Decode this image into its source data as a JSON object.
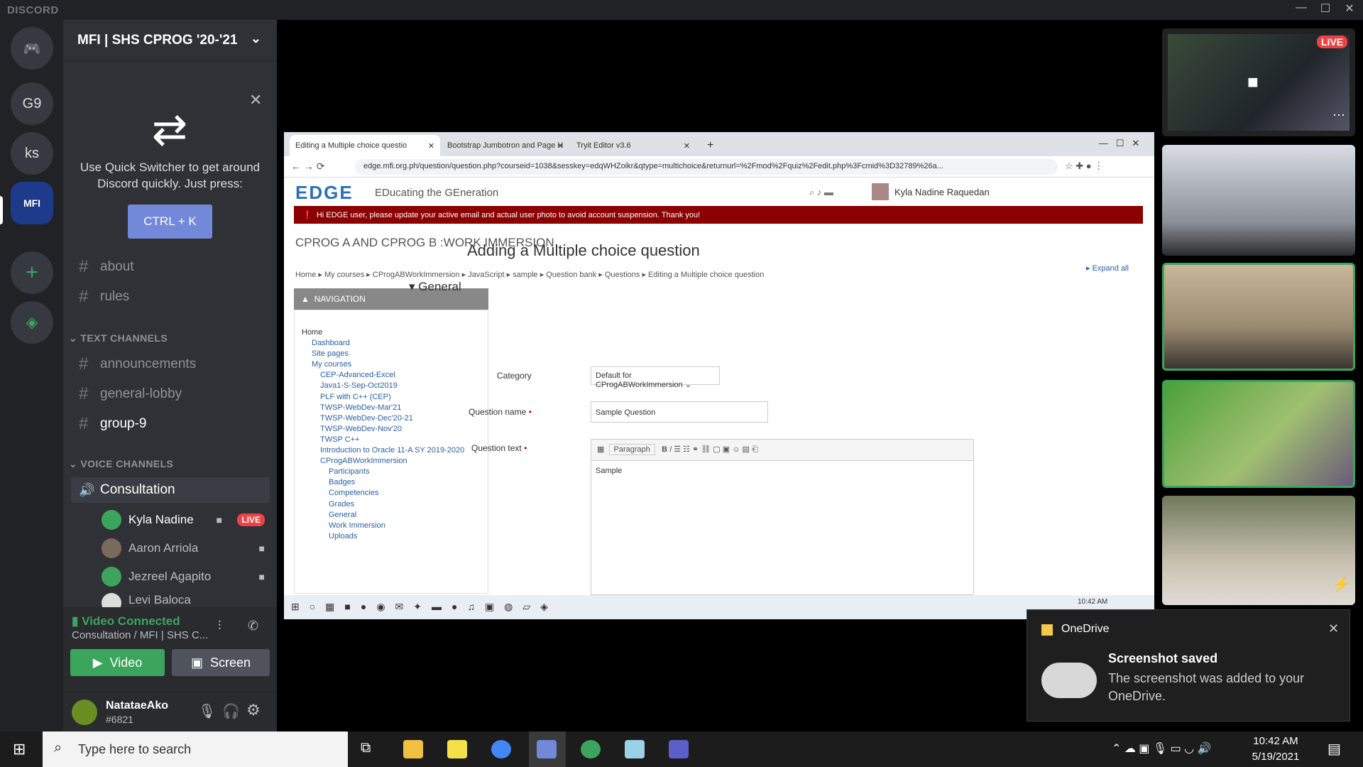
{
  "app": {
    "brand": "DISCORD"
  },
  "rail": {
    "servers": [
      "G9",
      "ks"
    ]
  },
  "guild": {
    "name": "MFI | SHS CPROG '20-'21"
  },
  "quick_switcher": {
    "text": "Use Quick Switcher to get around Discord quickly. Just press:",
    "shortcut": "CTRL + K"
  },
  "channels": {
    "top": [
      "about",
      "rules"
    ],
    "text_category": "TEXT CHANNELS",
    "text": [
      "announcements",
      "general-lobby",
      "group-9"
    ],
    "voice_category": "VOICE CHANNELS",
    "voice_channel": "Consultation",
    "voice_users": [
      "Kyla Nadine",
      "Aaron Arriola",
      "Jezreel Agapito",
      "Levi Baloca"
    ],
    "live_label": "LIVE"
  },
  "voice_panel": {
    "status": "Video Connected",
    "location": "Consultation / MFI | SHS C...",
    "video_label": "Video",
    "screen_label": "Screen"
  },
  "user_panel": {
    "name": "NatataeAko",
    "tag": "#6821"
  },
  "browser": {
    "tabs": [
      "Editing a Multiple choice questio",
      "Bootstrap Jumbotron and Page H",
      "Tryit Editor v3.6"
    ],
    "url": "edge.mfi.org.ph/question/question.php?courseid=1038&sesskey=edqWHZoikr&qtype=multichoice&returnurl=%2Fmod%2Fquiz%2Fedit.php%3Fcmid%3D32789%26a...",
    "site_logo": "EDGE",
    "site_tagline": "EDucating the GEneration",
    "user_name": "Kyla Nadine Raquedan",
    "alert": "Hi EDGE user, please update your active email and actual user photo to avoid account suspension. Thank you!",
    "course_title": "CPROG A AND CPROG B :WORK IMMERSION",
    "breadcrumb": [
      "Home",
      "My courses",
      "CProgABWorkImmersion",
      "JavaScript",
      "sample",
      "Question bank",
      "Questions",
      "Editing a Multiple choice question"
    ],
    "nav_title": "NAVIGATION",
    "nav_items": [
      "Home",
      "Dashboard",
      "Site pages",
      "My courses",
      "CEP-Advanced-Excel",
      "Java1-S-Sep-Oct2019",
      "PLF with C++ (CEP)",
      "TWSP-WebDev-Mar'21",
      "TWSP-WebDev-Dec'20-21",
      "TWSP-WebDev-Nov'20",
      "TWSP C++",
      "Introduction to Oracle 11-A SY 2019-2020",
      "CProgABWorkImmersion",
      "Participants",
      "Badges",
      "Competencies",
      "Grades",
      "General",
      "Work Immersion",
      "Uploads"
    ],
    "page_heading": "Adding a Multiple choice question",
    "expand_all": "Expand all",
    "section": "General",
    "category_label": "Category",
    "category_value": "Default for CProgABWorkImmersion",
    "qname_label": "Question name",
    "qname_value": "Sample Question",
    "qtext_label": "Question text",
    "editor_style": "Paragraph",
    "qtext_value": "Sample",
    "inner_clock": "10:42 AM"
  },
  "stream": {
    "live_badge": "LIVE"
  },
  "toast": {
    "app": "OneDrive",
    "title": "Screenshot saved",
    "body": "The screenshot was added to your OneDrive."
  },
  "taskbar": {
    "search_placeholder": "Type here to search",
    "time": "10:42 AM",
    "date": "5/19/2021"
  },
  "colors": {
    "blurple": "#7289da",
    "green": "#3ba55d",
    "live_red": "#ed4245",
    "alert_red": "#8b0000"
  }
}
